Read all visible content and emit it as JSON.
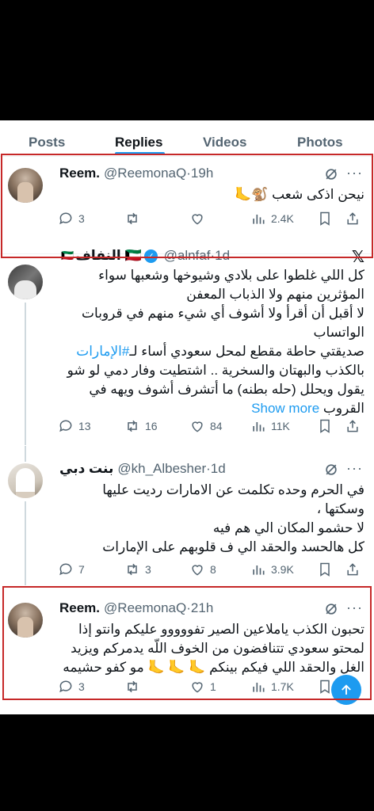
{
  "tabs": [
    {
      "label": "Posts"
    },
    {
      "label": "Replies"
    },
    {
      "label": "Videos"
    },
    {
      "label": "Photos"
    }
  ],
  "active_tab": "Replies",
  "tweets": [
    {
      "name": "Reem.",
      "handle": "@ReemonaQ",
      "time": "19h",
      "text": "نيحن اذكى شعب 🐒🦶",
      "replies": "3",
      "reposts": "",
      "likes": "",
      "views": "2.4K"
    },
    {
      "name": "النفاف 🇰🇼",
      "flag_prefix": "🇰🇼",
      "handle": "@alnfaf",
      "time": "1d",
      "text_lines": [
        "كل اللي غلطوا على بلادي وشيوخها وشعبها سواء",
        "المؤثرين منهم ولا الذباب المعفن",
        "لا أقبل أن أقرأ ولا أشوف أي شيء منهم في قروبات",
        "الواتساب",
        "صديقتي حاطة مقطع لمحل سعودي أساء لـ",
        "بالكذب والبهتان والسخرية .. اشتطيت وفار دمي لو شو",
        "يقول ويحلل (حله بطنه) ما أتشرف أشوف ويهه في",
        "القروب"
      ],
      "hashtag": "#الإمارات",
      "show_more": "Show more",
      "replies": "13",
      "reposts": "16",
      "likes": "84",
      "views": "11K"
    },
    {
      "name": "بنت دبي",
      "handle": "@kh_Albesher",
      "time": "1d",
      "text_lines": [
        "في الحرم وحده تكلمت عن الامارات رديت عليها",
        "وسكتها ،",
        "لا حشمو المكان الي هم فيه",
        "كل هالحسد والحقد الي ف قلوبهم على الإمارات"
      ],
      "replies": "7",
      "reposts": "3",
      "likes": "8",
      "views": "3.9K"
    },
    {
      "name": "Reem.",
      "handle": "@ReemonaQ",
      "time": "21h",
      "text_lines": [
        "تحبون الكذب ياملاعين الصير تفووووو عليكم وانتو إذا",
        "لمحتو سعودي تتنافضون من الخوف اللّه يدمركم ويزيد",
        "الغل والحقد اللي فيكم بينكم 🦶 🦶 🦶 مو كفو حشيمه"
      ],
      "replies": "3",
      "reposts": "",
      "likes": "1",
      "views": "1.7K"
    }
  ],
  "colors": {
    "accent": "#1d9bf0",
    "text": "#0f1419",
    "muted": "#536471",
    "highlight_box": "#c62828"
  }
}
